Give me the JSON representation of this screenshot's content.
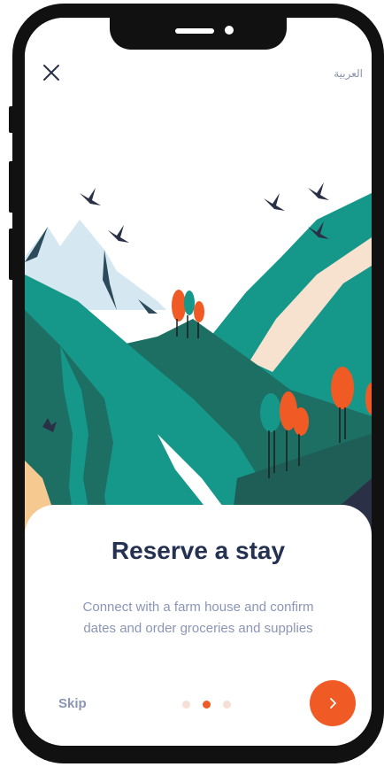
{
  "header": {
    "close_icon": "close-icon",
    "language_label": "العربية"
  },
  "status_bar": {
    "icons": [
      "wifi-icon",
      "battery-icon"
    ]
  },
  "onboarding": {
    "title": "Reserve a stay",
    "description_line1": "Connect with a farm house and confirm",
    "description_line2": "dates and order groceries and supplies",
    "skip_label": "Skip",
    "page_count": 3,
    "active_page": 2,
    "next_icon": "chevron-right-icon"
  },
  "colors": {
    "accent": "#f05a24",
    "title": "#243150",
    "muted": "#8b95b6",
    "teal": "#15978a",
    "dark_teal": "#1c6f62",
    "sky": "#d6e9f2",
    "cream": "#f6e2cf"
  }
}
